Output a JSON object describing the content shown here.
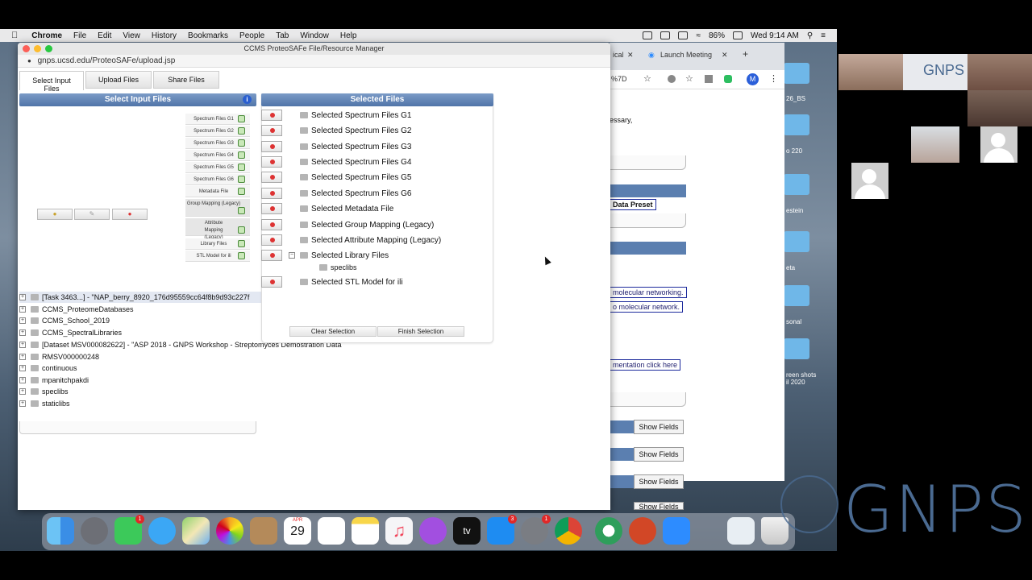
{
  "menubar": {
    "app": "Chrome",
    "items": [
      "File",
      "Edit",
      "View",
      "History",
      "Bookmarks",
      "People",
      "Tab",
      "Window",
      "Help"
    ],
    "battery": "86%",
    "clock": "Wed 9:14 AM"
  },
  "window": {
    "title": "CCMS ProteoSAFe File/Resource Manager",
    "url": "gnps.ucsd.edu/ProteoSAFe/upload.jsp"
  },
  "tabs": [
    "Select Input Files",
    "Upload Files",
    "Share Files"
  ],
  "left_panel": {
    "title": "Select Input Files",
    "types": [
      "Spectrum Files G1",
      "Spectrum Files G2",
      "Spectrum Files G3",
      "Spectrum Files G4",
      "Spectrum Files G5",
      "Spectrum Files G6",
      "Metadata File",
      "Group Mapping (Legacy)",
      "Attribute Mapping (Legacy)",
      "Library Files",
      "STL Model for ili"
    ],
    "tree": [
      "[Task 3463...] - \"NAP_berry_8920_176d95559cc64f8b9d93c227f",
      "CCMS_ProteomeDatabases",
      "CCMS_School_2019",
      "CCMS_SpectralLibraries",
      "[Dataset MSV000082622] - \"ASP 2018 - GNPS Workshop - Streptomyces Demostration Data",
      "RMSV000000248",
      "continuous",
      "mpanitchpakdi",
      "speclibs",
      "staticlibs"
    ]
  },
  "right_panel": {
    "title": "Selected Files",
    "items": [
      "Selected Spectrum Files G1",
      "Selected Spectrum Files G2",
      "Selected Spectrum Files G3",
      "Selected Spectrum Files G4",
      "Selected Spectrum Files G5",
      "Selected Spectrum Files G6",
      "Selected Metadata File",
      "Selected Group Mapping (Legacy)",
      "Selected Attribute Mapping (Legacy)",
      "Selected Library Files",
      "Selected STL Model for ili"
    ],
    "child": "speclibs",
    "clear_label": "Clear Selection",
    "finish_label": "Finish Selection"
  },
  "background_browser": {
    "tab1": "ical",
    "tab2": "Launch Meeting",
    "url_fragment": "%7D",
    "snippets": [
      "essary,",
      "Data Preset",
      "molecular networking.",
      "o molecular network.",
      "mentation click here"
    ],
    "show_fields": "Show Fields",
    "avatar_letter": "M"
  },
  "desktop_labels": [
    "26_BS",
    "o 220",
    "estein",
    "eta",
    "sonal",
    "reen shots\nil 2020"
  ],
  "dock_badges": [
    "1",
    "3",
    "1"
  ],
  "calendar_day": "29",
  "calendar_month": "APR",
  "tv_label": "tv",
  "gnps_brand": "GNPS"
}
